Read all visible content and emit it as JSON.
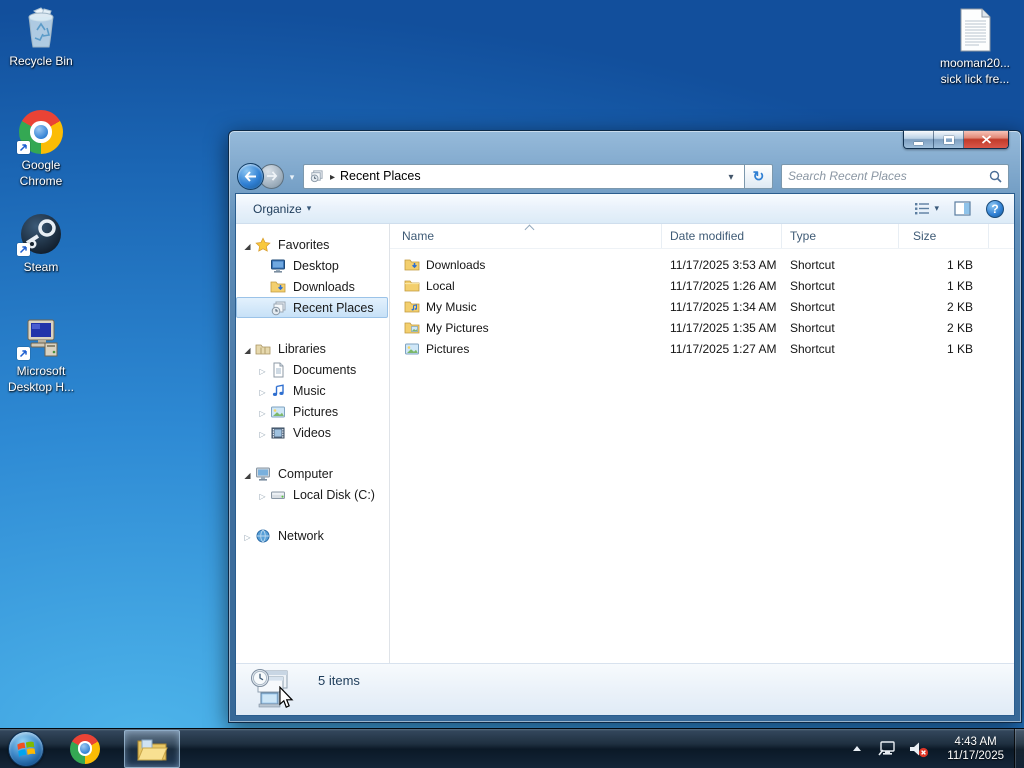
{
  "desktop": {
    "icons": {
      "recycle_bin": "Recycle Bin",
      "chrome": "Google Chrome",
      "steam": "Steam",
      "ms_desktop": "Microsoft Desktop H...",
      "mooman_line1": "mooman20...",
      "mooman_line2": "sick lick fre..."
    }
  },
  "window": {
    "address": {
      "breadcrumb": "Recent Places",
      "search_placeholder": "Search Recent Places"
    },
    "toolbar": {
      "organize_label": "Organize"
    },
    "nav": {
      "favorites": "Favorites",
      "favorites_items": [
        "Desktop",
        "Downloads",
        "Recent Places"
      ],
      "libraries": "Libraries",
      "libraries_items": [
        "Documents",
        "Music",
        "Pictures",
        "Videos"
      ],
      "computer": "Computer",
      "computer_items": [
        "Local Disk (C:)"
      ],
      "network": "Network"
    },
    "list": {
      "columns": [
        "Name",
        "Date modified",
        "Type",
        "Size"
      ],
      "rows": [
        {
          "name": "Downloads",
          "date": "11/17/2025 3:53 AM",
          "type": "Shortcut",
          "size": "1 KB"
        },
        {
          "name": "Local",
          "date": "11/17/2025 1:26 AM",
          "type": "Shortcut",
          "size": "1 KB"
        },
        {
          "name": "My Music",
          "date": "11/17/2025 1:34 AM",
          "type": "Shortcut",
          "size": "2 KB"
        },
        {
          "name": "My Pictures",
          "date": "11/17/2025 1:35 AM",
          "type": "Shortcut",
          "size": "2 KB"
        },
        {
          "name": "Pictures",
          "date": "11/17/2025 1:27 AM",
          "type": "Shortcut",
          "size": "1 KB"
        }
      ]
    },
    "details": {
      "items_count": "5 items"
    }
  },
  "taskbar": {
    "clock_time": "4:43 AM",
    "clock_date": "11/17/2025"
  },
  "colors": {
    "aero_glass_blue": "#406f9e",
    "selection_blue": "#c7e1f7",
    "close_button_red": "#c23b2a",
    "desktop_blue": "#2e8ad4",
    "folder_yellow": "#f3cf6e"
  }
}
